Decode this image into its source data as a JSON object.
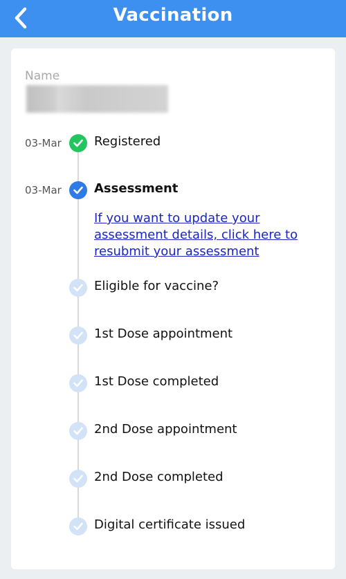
{
  "header": {
    "title": "Vaccination",
    "back_icon": "chevron-left-icon",
    "color": "#3d8ff0"
  },
  "profile": {
    "name_label": "Name",
    "name_value": ""
  },
  "timeline": {
    "steps": [
      {
        "date": "03-Mar",
        "label": "Registered",
        "status": "done",
        "icon": "check-circle-green-icon"
      },
      {
        "date": "03-Mar",
        "label": "Assessment",
        "status": "current",
        "icon": "check-circle-blue-icon"
      },
      {
        "date": "",
        "label": "Eligible for vaccine?",
        "status": "pending",
        "icon": "check-circle-light-icon"
      },
      {
        "date": "",
        "label": "1st Dose appointment",
        "status": "pending",
        "icon": "check-circle-light-icon"
      },
      {
        "date": "",
        "label": "1st Dose completed",
        "status": "pending",
        "icon": "check-circle-light-icon"
      },
      {
        "date": "",
        "label": "2nd Dose appointment",
        "status": "pending",
        "icon": "check-circle-light-icon"
      },
      {
        "date": "",
        "label": "2nd Dose completed",
        "status": "pending",
        "icon": "check-circle-light-icon"
      },
      {
        "date": "",
        "label": "Digital certificate issued",
        "status": "pending",
        "icon": "check-circle-light-icon"
      }
    ],
    "assessment_link": "If you want to update your assessment details, click here to resubmit your assessment"
  },
  "colors": {
    "done": "#22c55e",
    "current": "#2f7be5",
    "pending": "#d2e3f7",
    "link": "#1a24c9"
  }
}
